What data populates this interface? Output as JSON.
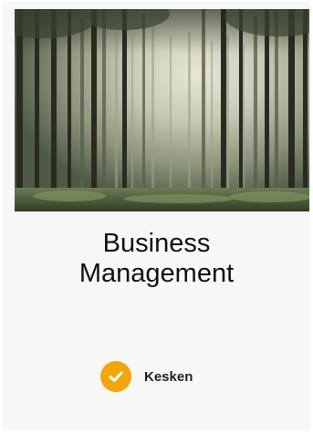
{
  "card": {
    "title_line1": "Business",
    "title_line2": "Management",
    "image_icon": "forest-photo",
    "status": {
      "label": "Kesken",
      "icon": "check-circle-icon",
      "color": "#f2a60c"
    }
  }
}
